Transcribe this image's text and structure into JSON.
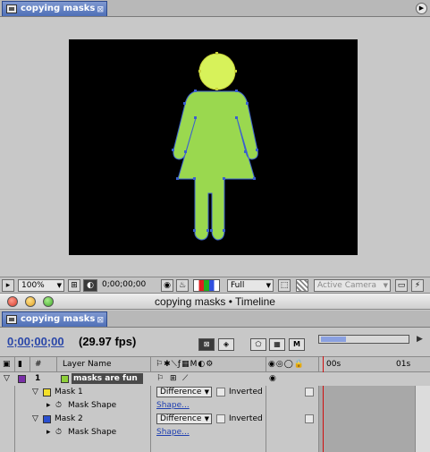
{
  "composition": {
    "tab_label": "copying masks",
    "zoom": "100%",
    "timecode": "0;00;00;00",
    "resolution": "Full",
    "camera": "Active Camera",
    "figure_fill": "#9ad84f",
    "head_fill": "#d7f25a",
    "viewer_bg": "#000000"
  },
  "timeline": {
    "window_title": "copying masks • Timeline",
    "tab_label": "copying masks",
    "timecode": "0;00;00;00",
    "fps": "(29.97 fps)",
    "columns": {
      "number": "#",
      "layer_name": "Layer Name"
    },
    "ruler": {
      "start": "00s",
      "next": "01s"
    },
    "layers": [
      {
        "number": "1",
        "name": "masks are fun",
        "label_color": "#7a2fa8",
        "swatch_color": "#8ecf3a"
      }
    ],
    "masks": [
      {
        "name": "Mask 1",
        "mode": "Difference",
        "inverted_label": "Inverted",
        "color": "#f4e02a",
        "shape_label": "Mask Shape",
        "shape_value": "Shape..."
      },
      {
        "name": "Mask 2",
        "mode": "Difference",
        "inverted_label": "Inverted",
        "color": "#2a4fd0",
        "shape_label": "Mask Shape",
        "shape_value": "Shape..."
      }
    ],
    "layer_bar_color": "#b36fd6",
    "cti_color": "#d01010"
  }
}
